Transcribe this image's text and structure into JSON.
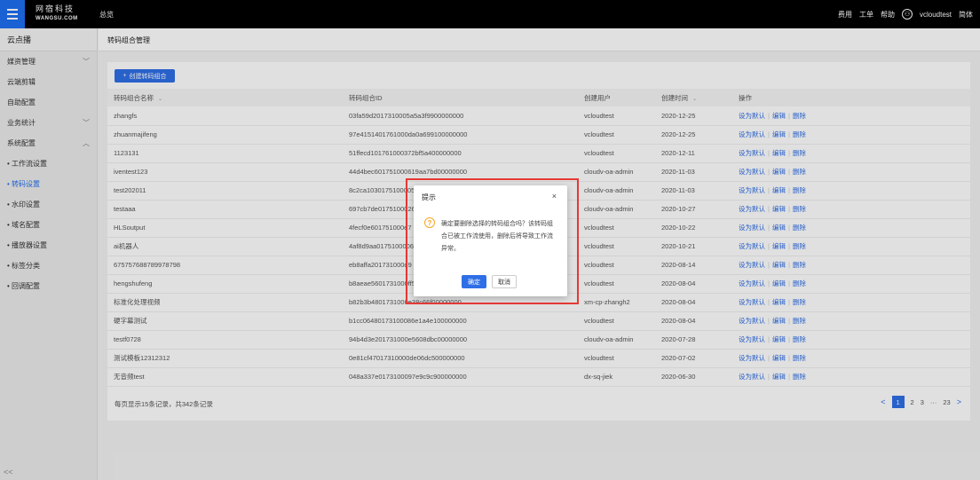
{
  "topbar": {
    "logo_cn": "网宿科技",
    "logo_en": "WANGSU.COM",
    "nav_overview": "总览",
    "right_items": [
      "费用",
      "工单",
      "帮助"
    ],
    "username": "vcloudtest",
    "lang": "简体"
  },
  "sidebar": {
    "title": "云点播",
    "items": [
      {
        "label": "媒资管理",
        "chevron": "﹀"
      },
      {
        "label": "云端剪辑",
        "chevron": ""
      },
      {
        "label": "自助配置",
        "chevron": ""
      },
      {
        "label": "业务统计",
        "chevron": "﹀"
      },
      {
        "label": "系统配置",
        "chevron": "︿"
      }
    ],
    "subitems": [
      {
        "label": "• 工作流设置",
        "active": false
      },
      {
        "label": "• 转码设置",
        "active": true
      },
      {
        "label": "• 水印设置",
        "active": false
      },
      {
        "label": "• 域名配置",
        "active": false
      },
      {
        "label": "• 播放器设置",
        "active": false
      },
      {
        "label": "• 标签分类",
        "active": false
      },
      {
        "label": "• 回调配置",
        "active": false
      }
    ],
    "collapse": "<<"
  },
  "page": {
    "title": "转码组合管理",
    "create_button": "创建转码组合"
  },
  "table": {
    "columns": [
      "转码组合名称",
      "转码组合ID",
      "创建用户",
      "创建时间",
      "操作"
    ],
    "actions": [
      "设为默认",
      "编辑",
      "删除"
    ],
    "rows": [
      [
        "zhangfs",
        "03fa59d2017310005a5a3f9900000000",
        "vcloudtest",
        "2020-12-25"
      ],
      [
        "zhuanmajifeng",
        "97e4151401761000da0a699100000000",
        "vcloudtest",
        "2020-12-25"
      ],
      [
        "1123131",
        "51ffecd101761000372bf5a400000000",
        "vcloudtest",
        "2020-12-11"
      ],
      [
        "iventest123",
        "44d4bec601751000619aa7bd00000000",
        "cloudv-oa-admin",
        "2020-11-03"
      ],
      [
        "test202011",
        "8c2ca10301751000050",
        "cloudv-oa-admin",
        "2020-11-03"
      ],
      [
        "testaaa",
        "697cb7de0175100026",
        "cloudv-oa-admin",
        "2020-10-27"
      ],
      [
        "HLSoutput",
        "4fecf0e601751000e7",
        "vcloudtest",
        "2020-10-22"
      ],
      [
        "ai机器人",
        "4af8d9aa0175100006b",
        "vcloudtest",
        "2020-10-21"
      ],
      [
        "675757688789978798",
        "eb8affa201731000d9",
        "vcloudtest",
        "2020-08-14"
      ],
      [
        "hengshufeng",
        "b8aeae5601731000ff5",
        "vcloudtest",
        "2020-08-04"
      ],
      [
        "标准化处理视频",
        "b82b3b4801731000e38c66f00000000",
        "xm-cp-zhangh2",
        "2020-08-04"
      ],
      [
        "硬字幕测试",
        "b1cc06480173100086e1a4e100000000",
        "vcloudtest",
        "2020-08-04"
      ],
      [
        "testf0728",
        "94b4d3e201731000e5608dbc00000000",
        "cloudv-oa-admin",
        "2020-07-28"
      ],
      [
        "测试模板12312312",
        "0e81cf47017310000de06dc500000000",
        "vcloudtest",
        "2020-07-02"
      ],
      [
        "无音频test",
        "048a337e0173100097e9c9c900000000",
        "dx-sq-jiek",
        "2020-06-30"
      ]
    ]
  },
  "pagination": {
    "info": "每页显示15条记录，共342条记录",
    "pages": [
      "1",
      "2",
      "3",
      "···",
      "23"
    ],
    "prev": "<",
    "next": ">"
  },
  "modal": {
    "title": "提示",
    "close": "×",
    "icon": "?",
    "message": "确定要删除选择的转码组合吗？该转码组合已被工作流使用，删除后将导致工作流异常。",
    "ok": "确定",
    "cancel": "取消"
  },
  "colors": {
    "accent": "#2f6fe6",
    "highlight_border": "#e53935",
    "warning": "#f5a623"
  }
}
